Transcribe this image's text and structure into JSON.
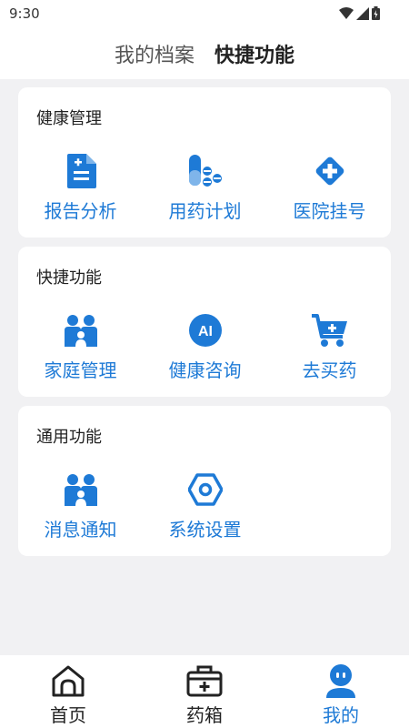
{
  "status_bar": {
    "time": "9:30"
  },
  "top_tabs": [
    {
      "label": "我的档案",
      "active": false
    },
    {
      "label": "快捷功能",
      "active": true
    }
  ],
  "sections": [
    {
      "title": "健康管理",
      "items": [
        {
          "label": "报告分析",
          "icon": "report-icon"
        },
        {
          "label": "用药计划",
          "icon": "medicine-icon"
        },
        {
          "label": "医院挂号",
          "icon": "hospital-icon"
        }
      ]
    },
    {
      "title": "快捷功能",
      "items": [
        {
          "label": "家庭管理",
          "icon": "family-icon"
        },
        {
          "label": "健康咨询",
          "icon": "ai-icon"
        },
        {
          "label": "去买药",
          "icon": "cart-icon"
        }
      ]
    },
    {
      "title": "通用功能",
      "items": [
        {
          "label": "消息通知",
          "icon": "people-icon"
        },
        {
          "label": "系统设置",
          "icon": "settings-icon"
        }
      ]
    }
  ],
  "bottom_nav": [
    {
      "label": "首页",
      "icon": "home-icon",
      "active": false
    },
    {
      "label": "药箱",
      "icon": "medicine-box-icon",
      "active": false
    },
    {
      "label": "我的",
      "icon": "profile-icon",
      "active": true
    }
  ],
  "colors": {
    "accent": "#1e7ad6",
    "background": "#f1f1f3"
  }
}
